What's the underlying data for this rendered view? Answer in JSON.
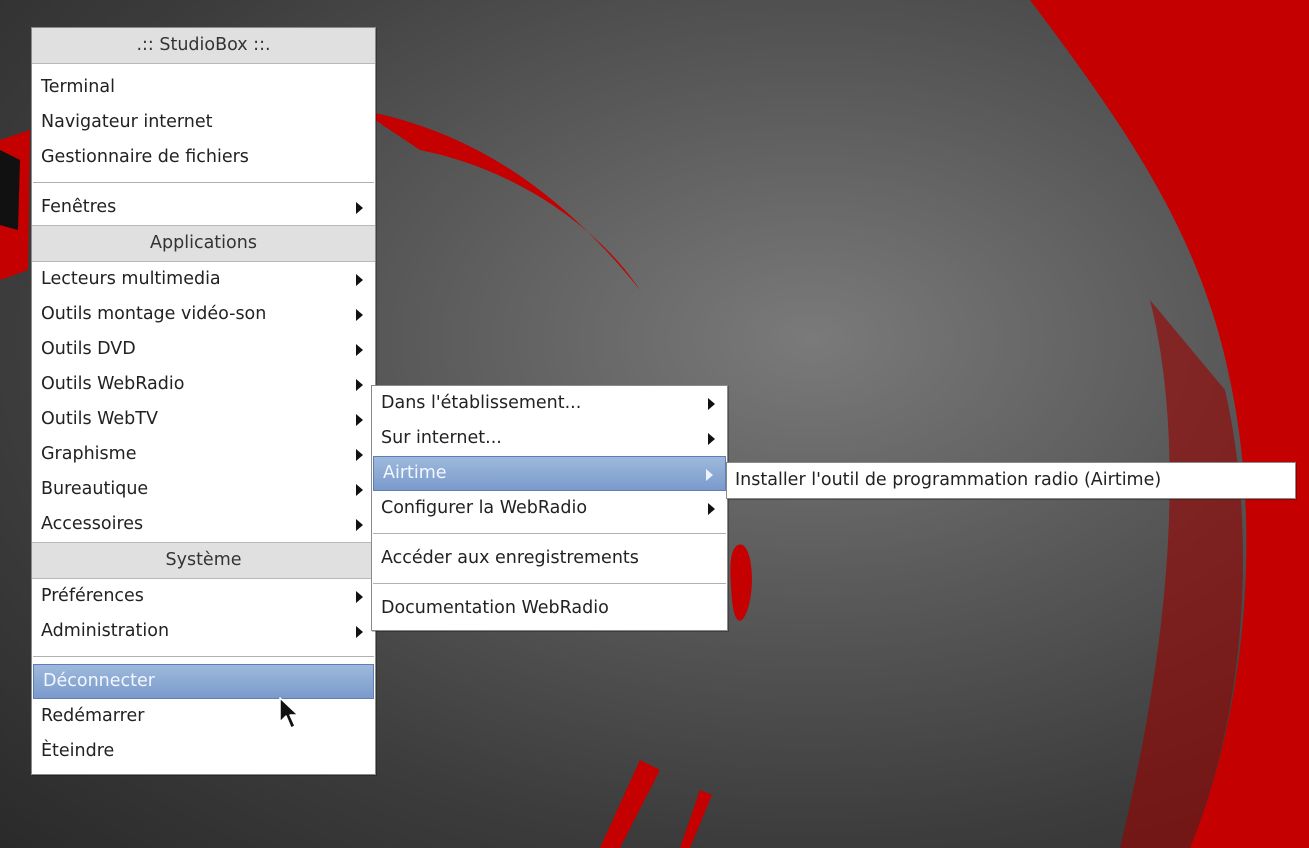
{
  "main_menu": {
    "title": ".:: StudioBox ::.",
    "top_items": [
      "Terminal",
      "Navigateur internet",
      "Gestionnaire de fichiers"
    ],
    "windows_item": "Fenêtres",
    "applications_header": "Applications",
    "applications": [
      "Lecteurs multimedia",
      "Outils montage vidéo-son",
      "Outils DVD",
      "Outils WebRadio",
      "Outils WebTV",
      "Graphisme",
      "Bureautique",
      "Accessoires"
    ],
    "system_header": "Système",
    "system": [
      "Préférences",
      "Administration"
    ],
    "session": [
      "Déconnecter",
      "Redémarrer",
      "Èteindre"
    ]
  },
  "webradio_menu": {
    "items": [
      "Dans l'établissement...",
      "Sur internet...",
      "Airtime",
      "Configurer la WebRadio",
      "Accéder aux enregistrements",
      "Documentation WebRadio"
    ]
  },
  "airtime_menu": {
    "items": [
      "Installer l'outil de programmation radio (Airtime)"
    ]
  },
  "colors": {
    "menu_bg": "#ffffff",
    "header_bg": "#e0e0e0",
    "selection": "#8aa6d2",
    "wallpaper_red": "#c40000"
  },
  "icons": [
    "submenu-arrow-icon",
    "mouse-pointer-icon"
  ]
}
